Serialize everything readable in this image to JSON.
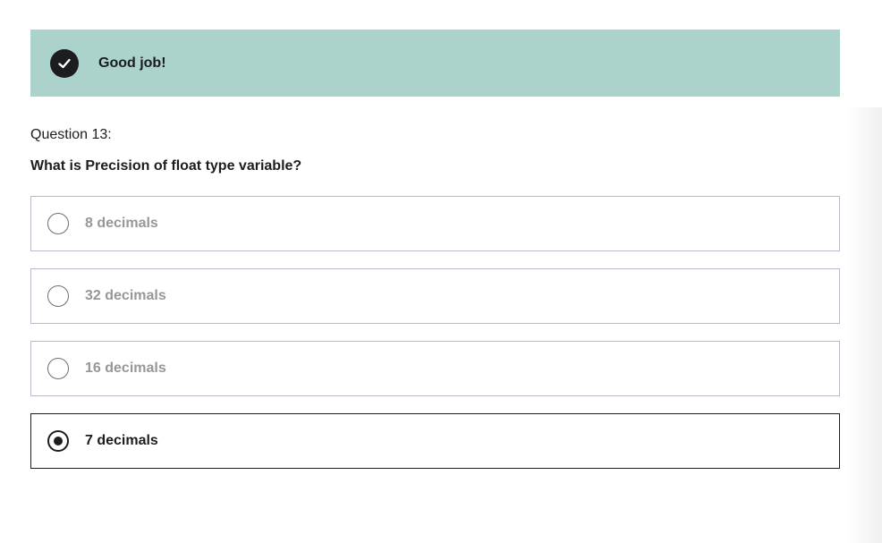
{
  "feedback": {
    "icon": "check-circle-icon",
    "message": "Good job!",
    "background_color": "#acd2cc"
  },
  "question": {
    "number_label": "Question 13:",
    "prompt": "What is Precision of float type variable?"
  },
  "options": [
    {
      "label": "8 decimals",
      "selected": false
    },
    {
      "label": "32 decimals",
      "selected": false
    },
    {
      "label": "16 decimals",
      "selected": false
    },
    {
      "label": "7 decimals",
      "selected": true
    }
  ]
}
